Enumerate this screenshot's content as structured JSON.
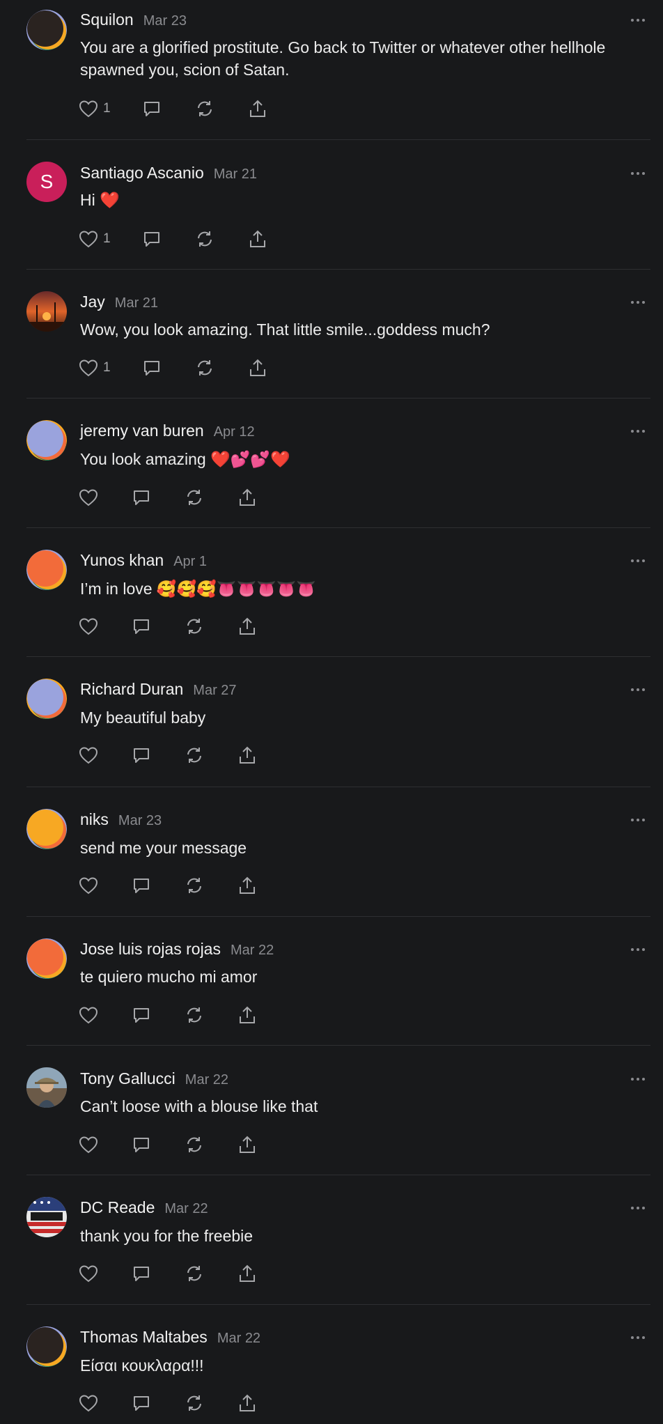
{
  "comments": [
    {
      "author": "Squilon",
      "date": "Mar 23",
      "text": "You are a glorified prostitute. Go back to Twitter or whatever other hellhole spawned you, scion of Satan.",
      "likes": "1",
      "avatar": {
        "type": "blob",
        "color": "#2a2320"
      }
    },
    {
      "author": "Santiago Ascanio",
      "date": "Mar 21",
      "text": "Hi ❤️",
      "likes": "1",
      "avatar": {
        "type": "letter",
        "letter": "S",
        "color": "#c91f5a"
      }
    },
    {
      "author": "Jay",
      "date": "Mar 21",
      "text": "Wow, you look amazing. That little smile...goddess much?",
      "likes": "1",
      "avatar": {
        "type": "photo",
        "color": "#c0532a"
      }
    },
    {
      "author": "jeremy van buren",
      "date": "Apr 12",
      "text": "You look amazing ❤️💕💕❤️",
      "likes": "",
      "avatar": {
        "type": "blob",
        "color": "#9aa3dd"
      }
    },
    {
      "author": "Yunos khan",
      "date": "Apr 1",
      "text": "I’m in love 🥰🥰🥰👅👅👅👅👅",
      "likes": "",
      "avatar": {
        "type": "blob",
        "color": "#f26b3a"
      }
    },
    {
      "author": "Richard Duran",
      "date": "Mar 27",
      "text": "My beautiful baby",
      "likes": "",
      "avatar": {
        "type": "blob",
        "color": "#9aa3dd"
      }
    },
    {
      "author": "niks",
      "date": "Mar 23",
      "text": "send me your message",
      "likes": "",
      "avatar": {
        "type": "blob",
        "color": "#f7a823"
      }
    },
    {
      "author": "Jose luis rojas rojas",
      "date": "Mar 22",
      "text": "te quiero mucho mi amor",
      "likes": "",
      "avatar": {
        "type": "blob",
        "color": "#f26b3a"
      }
    },
    {
      "author": "Tony Gallucci",
      "date": "Mar 22",
      "text": "Can’t loose with a blouse like that",
      "likes": "",
      "avatar": {
        "type": "photo",
        "color": "#7a8a9a"
      }
    },
    {
      "author": "DC Reade",
      "date": "Mar 22",
      "text": "thank you for the freebie",
      "likes": "",
      "avatar": {
        "type": "photo",
        "color": "#2b3f7a"
      }
    },
    {
      "author": "Thomas Maltabes",
      "date": "Mar 22",
      "text": "Είσαι κουκλαρα!!!",
      "likes": "",
      "avatar": {
        "type": "blob",
        "color": "#2a2320"
      }
    }
  ],
  "icons": {
    "like": "heart-icon",
    "reply": "comment-icon",
    "repost": "repost-icon",
    "share": "share-icon",
    "more": "more-icon"
  }
}
